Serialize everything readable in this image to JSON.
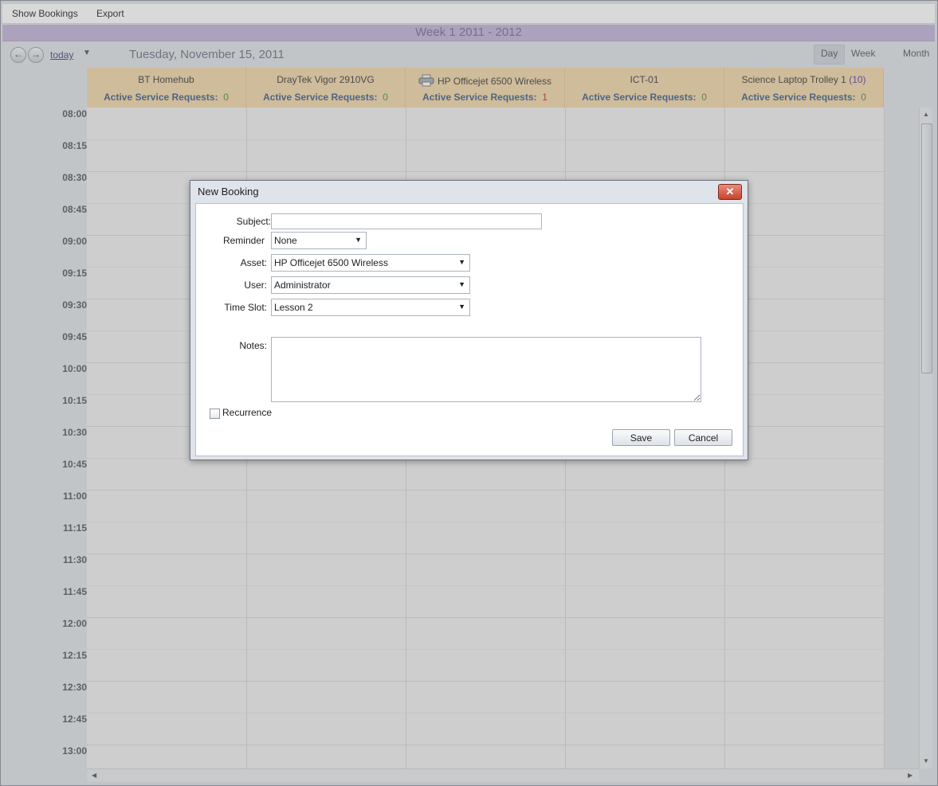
{
  "menu": {
    "show_bookings": "Show Bookings",
    "export": "Export"
  },
  "week_title": "Week 1 2011 - 2012",
  "nav": {
    "today": "today",
    "date": "Tuesday, November 15, 2011",
    "views": [
      "Day",
      "Week",
      "Month"
    ],
    "active_view": "Day"
  },
  "resources": [
    {
      "name": "BT Homehub",
      "requests_label": "Active Service Requests:",
      "requests": "0",
      "extra": ""
    },
    {
      "name": "DrayTek Vigor 2910VG",
      "requests_label": "Active Service Requests:",
      "requests": "0",
      "extra": ""
    },
    {
      "name": "HP Officejet 6500 Wireless",
      "requests_label": "Active Service Requests:",
      "requests": "1",
      "extra": "",
      "icon": "printer-icon"
    },
    {
      "name": "ICT-01",
      "requests_label": "Active Service Requests:",
      "requests": "0",
      "extra": ""
    },
    {
      "name": "Science Laptop Trolley 1",
      "requests_label": "Active Service Requests:",
      "requests": "0",
      "extra": "(10)"
    }
  ],
  "times": [
    "08:00",
    "08:15",
    "08:30",
    "08:45",
    "09:00",
    "09:15",
    "09:30",
    "09:45",
    "10:00",
    "10:15",
    "10:30",
    "10:45",
    "11:00",
    "11:15",
    "11:30",
    "11:45",
    "12:00",
    "12:15",
    "12:30",
    "12:45",
    "13:00"
  ],
  "dialog": {
    "title": "New Booking",
    "close_icon": "close-icon",
    "subject_label": "Subject:",
    "subject_value": "",
    "reminder_label": "Reminder",
    "reminder_value": "None",
    "asset_label": "Asset:",
    "asset_value": "HP Officejet 6500 Wireless",
    "user_label": "User:",
    "user_value": "Administrator",
    "timeslot_label": "Time Slot:",
    "timeslot_value": "Lesson 2",
    "notes_label": "Notes:",
    "notes_value": "",
    "recurrence_label": "Recurrence",
    "recurrence_checked": false,
    "save": "Save",
    "cancel": "Cancel"
  },
  "colors": {
    "week_bar": "#c3b3d8",
    "resource_header": "#f2d7a9",
    "request_count_ok": "#4e8d3c",
    "request_count_alert": "#d02a2a"
  }
}
